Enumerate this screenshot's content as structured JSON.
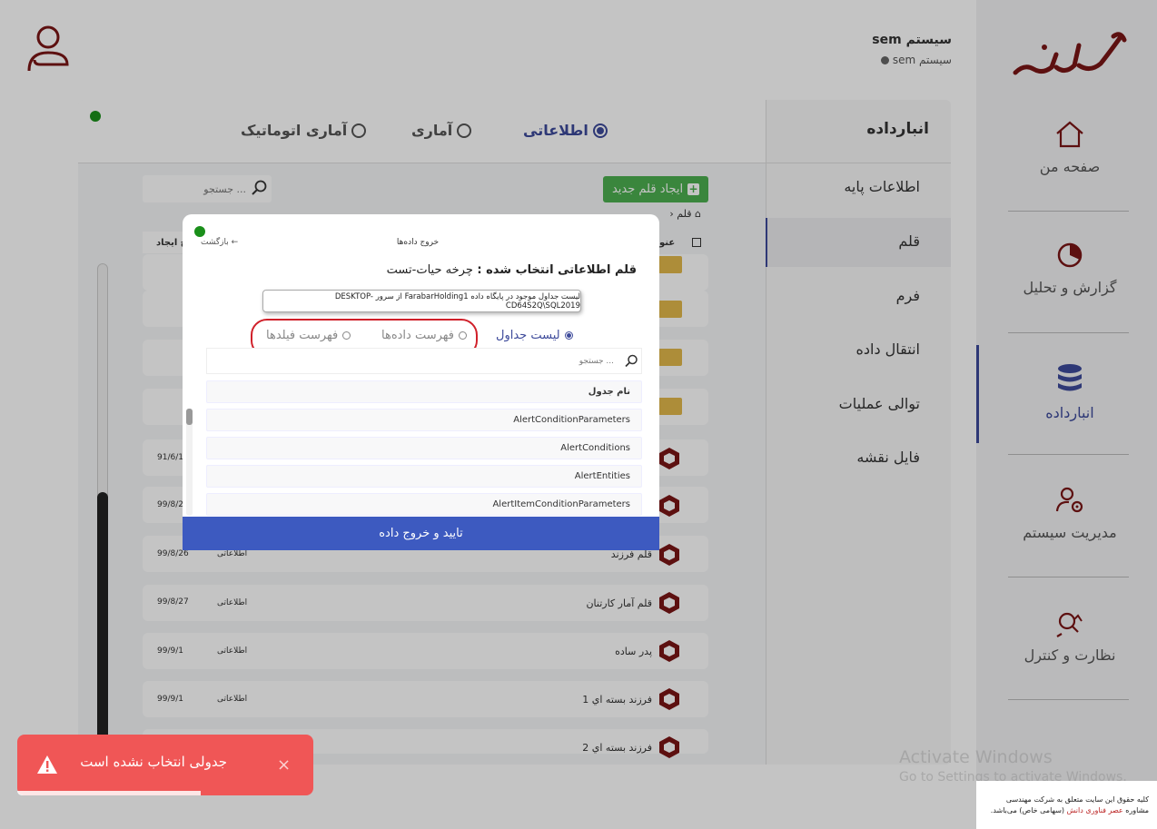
{
  "brand": {
    "logo_text": "فرابر"
  },
  "user": {
    "name": "sem سیستم",
    "sub": "sem سیستم"
  },
  "sidebar": {
    "items": [
      {
        "label": "صفحه من",
        "icon": "home-icon"
      },
      {
        "label": "گزارش و تحلیل",
        "icon": "pie-chart-icon"
      },
      {
        "label": "انبارداده",
        "icon": "database-icon",
        "active": true
      },
      {
        "label": "مدیریت سیستم",
        "icon": "user-gear-icon"
      },
      {
        "label": "نظارت و کنترل",
        "icon": "magnifier-icon"
      }
    ]
  },
  "section": {
    "title": "انبارداده",
    "items": [
      "اطلاعات پایه",
      "قلم",
      "فرم",
      "انتقال داده",
      "توالی عملیات",
      "فایل نقشه"
    ],
    "active": "قلم"
  },
  "type_tabs": [
    "اطلاعاتی",
    "آماری",
    "آماری اتوماتیک"
  ],
  "main": {
    "new_button": "ایجاد قلم جدید",
    "search_placeholder": "جستجو ...",
    "breadcrumb": "قلم",
    "columns": {
      "name": "عنو",
      "date": "یخ ایجاد"
    },
    "rows": [
      {
        "name": "قلم فرزند",
        "type": "اطلاعاتی",
        "date": "99/8/26"
      },
      {
        "name": "قلم آمار کارتنان",
        "type": "اطلاعاتی",
        "date": "99/8/27"
      },
      {
        "name": "پدر ساده",
        "type": "اطلاعاتی",
        "date": "99/9/1"
      },
      {
        "name": "فرزند بسته اي 1",
        "type": "اطلاعاتی",
        "date": "99/9/1"
      },
      {
        "name": "فرزند بسته اي 2",
        "type": "",
        "date": ""
      }
    ],
    "partial_dates": [
      "91/6/1",
      "99/8/2"
    ]
  },
  "modal": {
    "title": "خروج داده‌ها",
    "back": "بازگشت ←",
    "heading_label": "قلم اطلاعاتی انتخاب شده :",
    "heading_value": "چرخه حیات-تست",
    "tooltip": "لیست جداول موجود در پایگاه داده FarabarHolding1 از سرور DESKTOP-CD64S2Q\\SQL2019",
    "radios": [
      "لیست جداول",
      "فهرست داده‌ها",
      "فهرست فیلدها"
    ],
    "search_placeholder": "جستجو ...",
    "table_header": "نام جدول",
    "tables": [
      "AlertConditionParameters",
      "AlertConditions",
      "AlertEntities",
      "AlertItemConditionParameters"
    ],
    "confirm": "تایید و خروج داده"
  },
  "toast": {
    "message": "جدولی انتخاب نشده است",
    "close": "×",
    "progress": 0.62
  },
  "watermark": {
    "line1": "Activate Windows",
    "line2": "Go to Settings to activate Windows."
  },
  "footer": {
    "line1": "کلیه حقوق این سایت متعلق به شرکت مهندسی",
    "line2_pre": "مشاوره",
    "line2_hl": "عصر فناوری دانش",
    "line2_post": "(سهامی خاص) می‌باشد."
  },
  "colors": {
    "accent": "#3d4a9a",
    "success": "#4caf50",
    "danger": "#f05656",
    "logo": "#7a1515"
  }
}
